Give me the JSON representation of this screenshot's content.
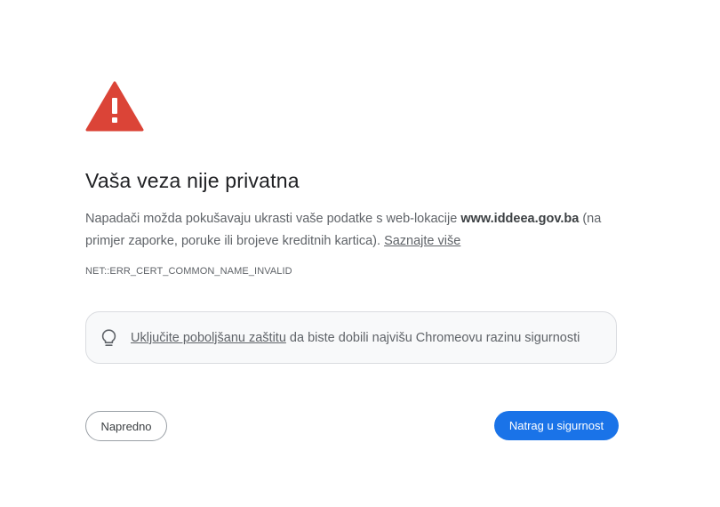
{
  "icons": {
    "warning": "warning-triangle-icon",
    "bulb": "lightbulb-icon"
  },
  "colors": {
    "warning_red": "#db4437",
    "primary_button": "#1a73e8"
  },
  "heading": "Vaša veza nije privatna",
  "description": {
    "before_domain": "Napadači možda pokušavaju ukrasti vaše podatke s web-lokacije ",
    "domain": "www.iddeea.gov.ba",
    "after_domain": " (na primjer zaporke, poruke ili brojeve kreditnih kartica). ",
    "learn_more": "Saznajte više"
  },
  "error_code": "NET::ERR_CERT_COMMON_NAME_INVALID",
  "protection": {
    "link": "Uključite poboljšanu zaštitu",
    "text": " da biste dobili najvišu Chromeovu razinu sigurnosti"
  },
  "buttons": {
    "advanced": "Napredno",
    "back_to_safety": "Natrag u sigurnost"
  }
}
